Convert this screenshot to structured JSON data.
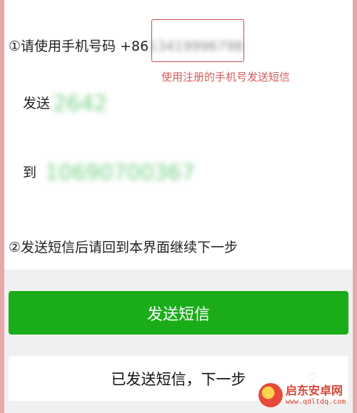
{
  "step1": {
    "text": "①请使用手机号码 +86",
    "phone_blurred": "13419996798"
  },
  "annotation": "使用注册的手机号发送短信",
  "send_row": {
    "label": "发送",
    "content_blurred": "2642"
  },
  "to_row": {
    "label": "到",
    "number_blurred": "10690700367"
  },
  "step2": "②发送短信后请回到本界面继续下一步",
  "buttons": {
    "send_sms": "发送短信",
    "sent_next": "已发送短信，下一步"
  },
  "watermark": {
    "name": "启东安卓网",
    "url": "www.qdltdq.com"
  },
  "colors": {
    "primary_button": "#1aad19",
    "annotation": "#d35b5b",
    "frame": "#e9a7a9"
  }
}
